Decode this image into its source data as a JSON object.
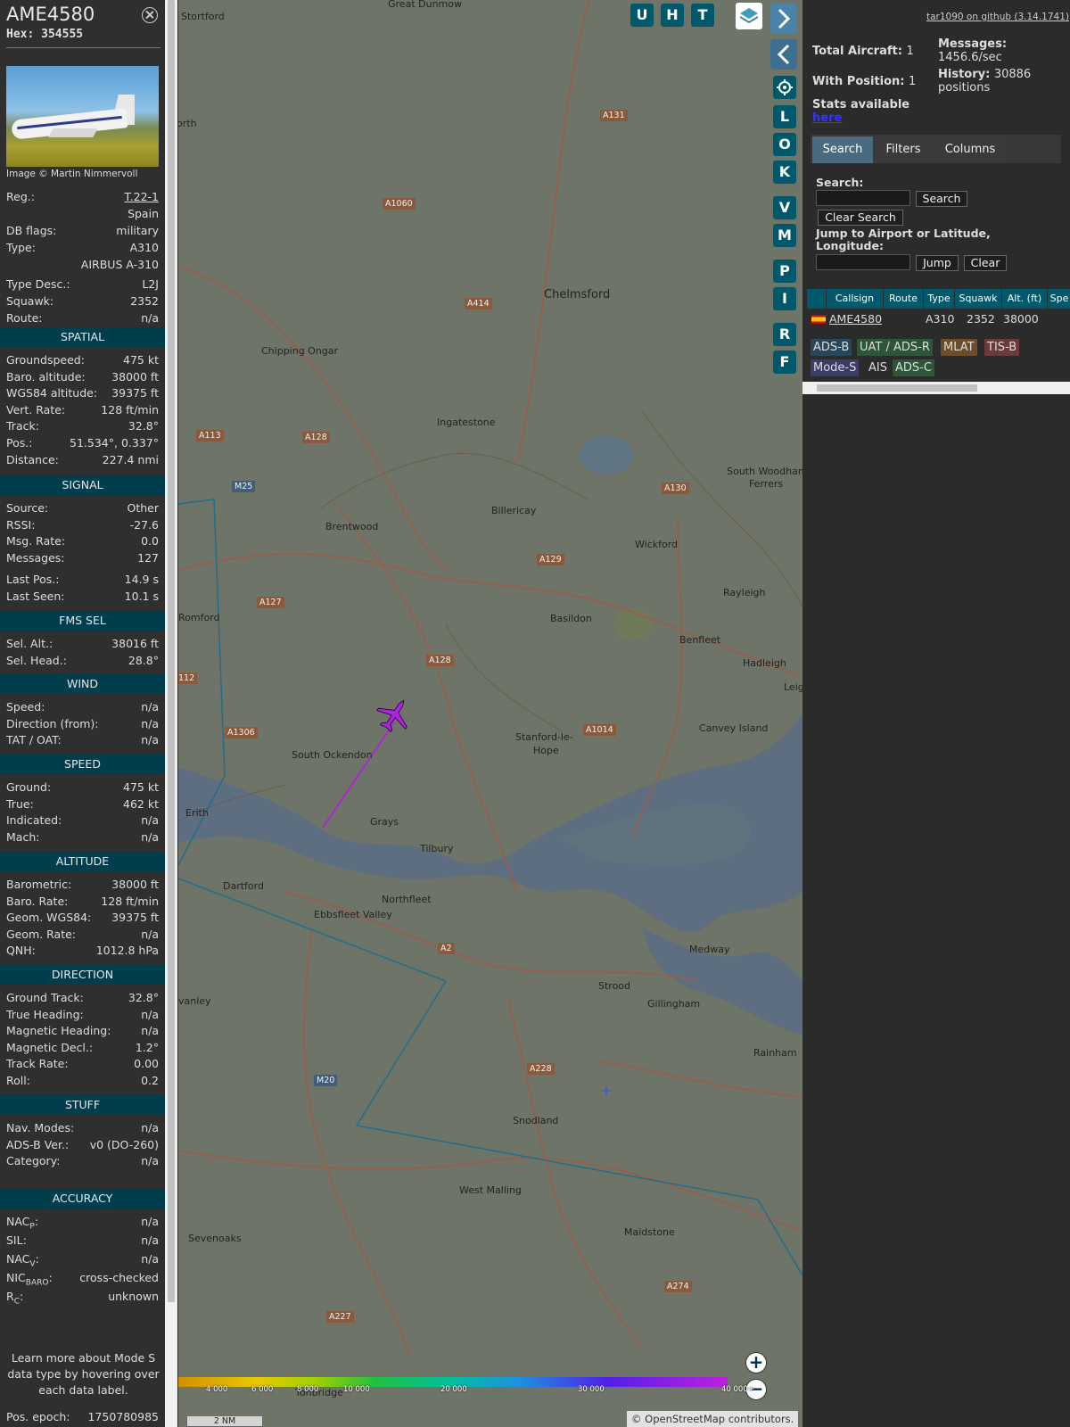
{
  "selected": {
    "callsign": "AME4580",
    "hex": "Hex: 354555",
    "photo_credit": "Image © Martin Nimmervoll",
    "info": [
      {
        "label": "Reg.:",
        "value": "T.22-1",
        "link": true
      },
      {
        "label": "",
        "value": "Spain"
      },
      {
        "label": "DB flags:",
        "value": "military"
      },
      {
        "label": "Type:",
        "value": "A310"
      },
      {
        "label": "",
        "value": "AIRBUS A-310"
      },
      {
        "label": "Type Desc.:",
        "value": "L2J"
      },
      {
        "label": "Squawk:",
        "value": "2352"
      },
      {
        "label": "Route:",
        "value": "n/a"
      }
    ],
    "sections": [
      {
        "title": "SPATIAL",
        "rows": [
          {
            "label": "Groundspeed:",
            "value": "475 kt"
          },
          {
            "label": "Baro. altitude:",
            "value": "38000 ft"
          },
          {
            "label": "WGS84 altitude:",
            "value": "39375 ft"
          },
          {
            "label": "Vert. Rate:",
            "value": "128 ft/min"
          },
          {
            "label": "Track:",
            "value": "32.8°"
          },
          {
            "label": "Pos.:",
            "value": "51.534°, 0.337°"
          },
          {
            "label": "Distance:",
            "value": "227.4 nmi"
          }
        ]
      },
      {
        "title": "SIGNAL",
        "rows": [
          {
            "label": "Source:",
            "value": "Other"
          },
          {
            "label": "RSSI:",
            "value": "-27.6"
          },
          {
            "label": "Msg. Rate:",
            "value": "0.0"
          },
          {
            "label": "Messages:",
            "value": "127"
          },
          {
            "label": "Last Pos.:",
            "value": "14.9 s"
          },
          {
            "label": "Last Seen:",
            "value": "10.1 s"
          }
        ]
      },
      {
        "title": "FMS SEL",
        "rows": [
          {
            "label": "Sel. Alt.:",
            "value": "38016 ft"
          },
          {
            "label": "Sel. Head.:",
            "value": "28.8°"
          }
        ]
      },
      {
        "title": "WIND",
        "rows": [
          {
            "label": "Speed:",
            "value": "n/a"
          },
          {
            "label": "Direction (from):",
            "value": "n/a"
          },
          {
            "label": "TAT / OAT:",
            "value": "n/a"
          }
        ]
      },
      {
        "title": "SPEED",
        "rows": [
          {
            "label": "Ground:",
            "value": "475 kt"
          },
          {
            "label": "True:",
            "value": "462 kt"
          },
          {
            "label": "Indicated:",
            "value": "n/a"
          },
          {
            "label": "Mach:",
            "value": "n/a"
          }
        ]
      },
      {
        "title": "ALTITUDE",
        "rows": [
          {
            "label": "Barometric:",
            "value": "38000 ft"
          },
          {
            "label": "Baro. Rate:",
            "value": "128 ft/min"
          },
          {
            "label": "Geom. WGS84:",
            "value": "39375 ft"
          },
          {
            "label": "Geom. Rate:",
            "value": "n/a"
          },
          {
            "label": "QNH:",
            "value": "1012.8 hPa"
          }
        ]
      },
      {
        "title": "DIRECTION",
        "rows": [
          {
            "label": "Ground Track:",
            "value": "32.8°"
          },
          {
            "label": "True Heading:",
            "value": "n/a"
          },
          {
            "label": "Magnetic Heading:",
            "value": "n/a"
          },
          {
            "label": "Magnetic Decl.:",
            "value": "1.2°"
          },
          {
            "label": "Track Rate:",
            "value": "0.00"
          },
          {
            "label": "Roll:",
            "value": "0.2"
          }
        ]
      },
      {
        "title": "STUFF",
        "rows": [
          {
            "label": "Nav. Modes:",
            "value": "n/a"
          },
          {
            "label": "ADS-B Ver.:",
            "value": "v0 (DO-260)"
          },
          {
            "label": "Category:",
            "value": "n/a"
          }
        ]
      },
      {
        "title": "ACCURACY",
        "rows": [
          {
            "label": "NAC",
            "sub": "P",
            "after": ":",
            "value": "n/a"
          },
          {
            "label": "SIL:",
            "value": "n/a"
          },
          {
            "label": "NAC",
            "sub": "V",
            "after": ":",
            "value": "n/a"
          },
          {
            "label": "NIC",
            "sub": "BARO",
            "after": ":",
            "value": "cross-checked"
          },
          {
            "label": "R",
            "sub": "C",
            "after": ":",
            "value": "unknown"
          }
        ]
      }
    ],
    "note": "Learn more about Mode S data type by hovering over each data label.",
    "pos_epoch": {
      "label": "Pos. epoch:",
      "value": "1750780985"
    }
  },
  "map": {
    "places": [
      {
        "name": "Great Dunmow",
        "big": false
      },
      {
        "name": "Stortford",
        "big": false
      },
      {
        "name": "orth",
        "big": false
      },
      {
        "name": "Chelmsford",
        "big": true
      },
      {
        "name": "Chipping Ongar",
        "big": false
      },
      {
        "name": "Ingatestone",
        "big": false
      },
      {
        "name": "South Woodham",
        "big": false
      },
      {
        "name": "Ferrers",
        "big": false
      },
      {
        "name": "Brentwood",
        "big": false
      },
      {
        "name": "Billericay",
        "big": false
      },
      {
        "name": "Wickford",
        "big": false
      },
      {
        "name": "Rayleigh",
        "big": false
      },
      {
        "name": "Romford",
        "big": false
      },
      {
        "name": "Basildon",
        "big": false
      },
      {
        "name": "Benfleet",
        "big": false
      },
      {
        "name": "Hadleigh",
        "big": false
      },
      {
        "name": "Leigh",
        "big": false
      },
      {
        "name": "Canvey Island",
        "big": false
      },
      {
        "name": "Stanford-le-",
        "big": false
      },
      {
        "name": "Hope",
        "big": false
      },
      {
        "name": "South Ockendon",
        "big": false
      },
      {
        "name": "Erith",
        "big": false
      },
      {
        "name": "Grays",
        "big": false
      },
      {
        "name": "Tilbury",
        "big": false
      },
      {
        "name": "Dartford",
        "big": false
      },
      {
        "name": "Northfleet",
        "big": false
      },
      {
        "name": "Ebbsfleet Valley",
        "big": false
      },
      {
        "name": "Strood",
        "big": false
      },
      {
        "name": "Gillingham",
        "big": false
      },
      {
        "name": "Rainham",
        "big": false
      },
      {
        "name": "vanley",
        "big": false
      },
      {
        "name": "Snodland",
        "big": false
      },
      {
        "name": "West Malling",
        "big": false
      },
      {
        "name": "Sevenoaks",
        "big": false
      },
      {
        "name": "Maidstone",
        "big": false
      },
      {
        "name": "Tonbridge",
        "big": false
      },
      {
        "name": "Medway",
        "big": false
      }
    ],
    "roads": [
      "A131",
      "A1060",
      "A414",
      "A113",
      "A128",
      "M25",
      "A130",
      "A129",
      "A127",
      "A128",
      "A1014",
      "A1306",
      "A2",
      "A228",
      "M20",
      "A274",
      "A227",
      "112"
    ],
    "side_buttons": [
      "U",
      "H",
      "T",
      "L",
      "O",
      "K",
      "V",
      "M",
      "P",
      "I",
      "R",
      "F"
    ],
    "altitude_ticks": [
      "4 000",
      "6 000",
      "8 000",
      "10 000",
      "20 000",
      "30 000",
      "40 000+"
    ],
    "scale_label": "2 NM",
    "attribution": "© OpenStreetMap contributors.",
    "attribution_link": "OpenStreetMap"
  },
  "right": {
    "github": "tar1090 on github (3.14.1741)",
    "total_label": "Total Aircraft:",
    "total_value": "1",
    "withpos_label": "With Position:",
    "withpos_value": "1",
    "msgs_label": "Messages:",
    "msgs_value": "1456.6/sec",
    "history_label": "History:",
    "history_value": "30886 positions",
    "stats_label": "Stats available",
    "stats_link": "here",
    "tabs": [
      "Search",
      "Filters",
      "Columns"
    ],
    "search_label": "Search:",
    "search_button": "Search",
    "clear_search_button": "Clear Search",
    "jump_label": "Jump to Airport or Latitude, Longitude:",
    "jump_button": "Jump",
    "clear_button": "Clear",
    "columns": [
      "Callsign",
      "Route",
      "Type",
      "Squawk",
      "Alt. (ft)",
      "Spe"
    ],
    "rows": [
      {
        "callsign": "AME4580",
        "route": "",
        "type": "A310",
        "squawk": "2352",
        "alt": "38000"
      }
    ],
    "badges": [
      {
        "text": "ADS-B",
        "bg": "#28475a"
      },
      {
        "text": "UAT / ADS-R",
        "bg": "#2c5637"
      },
      {
        "text": "MLAT",
        "bg": "#6b4d2c"
      },
      {
        "text": "TIS-B",
        "bg": "#6b3b3b"
      },
      {
        "text": "Mode-S",
        "bg": "#3c3c6b"
      },
      {
        "text": "AIS",
        "bg": "#2b2b2b"
      },
      {
        "text": "ADS-C",
        "bg": "#2c5637"
      }
    ]
  }
}
